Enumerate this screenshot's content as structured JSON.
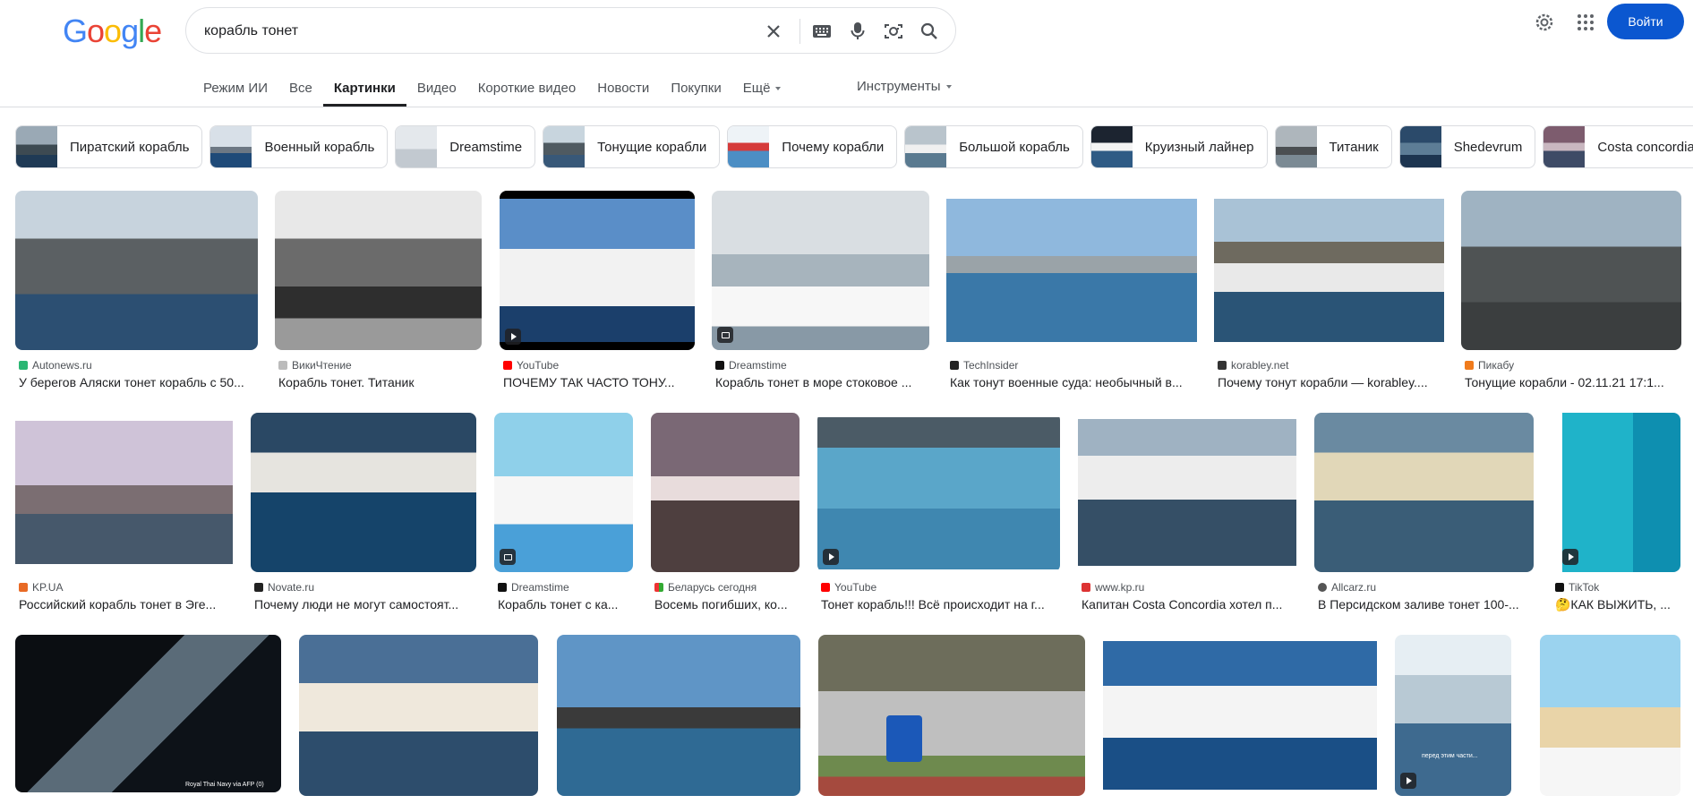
{
  "search": {
    "query": "корабль тонет",
    "clear_icon": "close-icon",
    "keyboard_icon": "keyboard-icon",
    "voice_icon": "microphone-icon",
    "lens_icon": "camera-icon",
    "search_icon": "search-icon"
  },
  "logo": {
    "text": "Google"
  },
  "header": {
    "settings_icon": "gear-icon",
    "apps_icon": "apps-grid-icon",
    "signin_label": "Войти"
  },
  "tabs": [
    {
      "label": "Режим ИИ"
    },
    {
      "label": "Все"
    },
    {
      "label": "Картинки",
      "active": true
    },
    {
      "label": "Видео"
    },
    {
      "label": "Короткие видео"
    },
    {
      "label": "Новости"
    },
    {
      "label": "Покупки"
    },
    {
      "label": "Ещё"
    }
  ],
  "tools_label": "Инструменты",
  "chips": [
    {
      "label": "Пиратский корабль"
    },
    {
      "label": "Военный корабль"
    },
    {
      "label": "Dreamstime"
    },
    {
      "label": "Тонущие корабли"
    },
    {
      "label": "Почему корабли"
    },
    {
      "label": "Большой корабль"
    },
    {
      "label": "Круизный лайнер"
    },
    {
      "label": "Титаник"
    },
    {
      "label": "Shedevrum"
    },
    {
      "label": "Costa concordia"
    }
  ],
  "results": [
    {
      "source": "Autonews.ru",
      "title": "У берегов Аляски тонет корабль с 50..."
    },
    {
      "source": "ВикиЧтение",
      "title": "Корабль тонет. Титаник"
    },
    {
      "source": "YouTube",
      "title": "ПОЧЕМУ ТАК ЧАСТО ТОНУ..."
    },
    {
      "source": "Dreamstime",
      "title": "Корабль тонет в море стоковое ..."
    },
    {
      "source": "TechInsider",
      "title": "Как тонут военные суда: необычный в..."
    },
    {
      "source": "korabley.net",
      "title": "Почему тонут корабли — korabley...."
    },
    {
      "source": "Пикабу",
      "title": "Тонущие корабли - 02.11.21 17:1..."
    },
    {
      "source": "KP.UA",
      "title": "Российский корабль тонет в Эге..."
    },
    {
      "source": "Novate.ru",
      "title": "Почему люди не могут самостоят..."
    },
    {
      "source": "Dreamstime",
      "title": "Корабль тонет с ка..."
    },
    {
      "source": "Беларусь сегодня",
      "title": "Восемь погибших, ко..."
    },
    {
      "source": "YouTube",
      "title": "Тонет корабль!!! Всё происходит на г..."
    },
    {
      "source": "www.kp.ru",
      "title": "Капитан Costa Concordia хотел п..."
    },
    {
      "source": "Allcarz.ru",
      "title": "В Персидском заливе тонет 100-..."
    },
    {
      "source": "TikTok",
      "title": "🤔КАК ВЫЖИТЬ, ..."
    }
  ],
  "row3_caption": "Royal Thai Navy via AFP (0)",
  "row3_video_caption": "перед этим части..."
}
